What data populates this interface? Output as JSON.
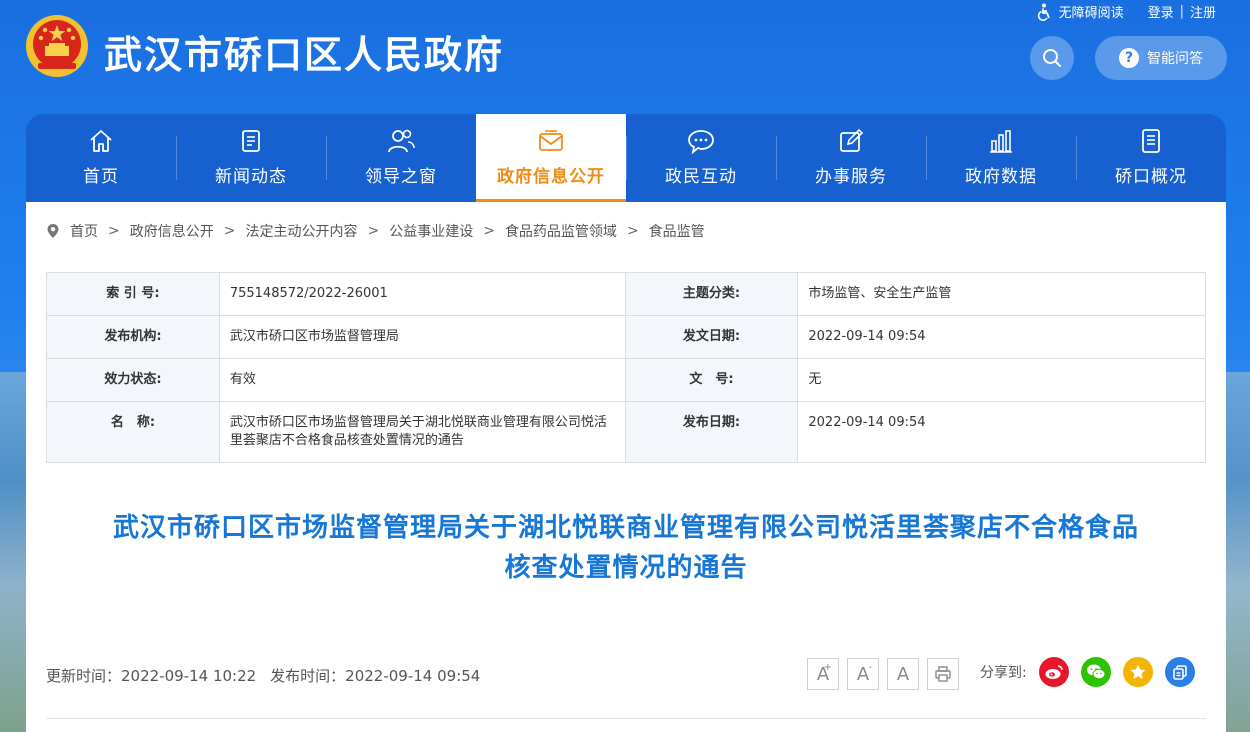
{
  "top": {
    "accessibility": "无障碍阅读",
    "login": "登录",
    "separator": "|",
    "register": "注册"
  },
  "header": {
    "site_title": "武汉市硚口区人民政府",
    "qa_label": "智能问答"
  },
  "nav": [
    {
      "label": "首页",
      "icon": "home-icon"
    },
    {
      "label": "新闻动态",
      "icon": "document-icon"
    },
    {
      "label": "领导之窗",
      "icon": "people-icon"
    },
    {
      "label": "政府信息公开",
      "icon": "mail-icon",
      "active": true
    },
    {
      "label": "政民互动",
      "icon": "chat-icon"
    },
    {
      "label": "办事服务",
      "icon": "edit-icon"
    },
    {
      "label": "政府数据",
      "icon": "bar-chart-icon"
    },
    {
      "label": "硚口概况",
      "icon": "list-icon"
    }
  ],
  "breadcrumb": [
    "首页",
    "政府信息公开",
    "法定主动公开内容",
    "公益事业建设",
    "食品药品监管领域",
    "食品监管"
  ],
  "breadcrumb_separator": ">",
  "info": {
    "index_label": "索 引 号:",
    "index_value": "755148572/2022-26001",
    "topic_label": "主题分类:",
    "topic_value": "市场监管、安全生产监管",
    "org_label": "发布机构:",
    "org_value": "武汉市硚口区市场监督管理局",
    "issue_date_label": "发文日期:",
    "issue_date_value": "2022-09-14 09:54",
    "status_label": "效力状态:",
    "status_value": "有效",
    "docno_label": "文　号:",
    "docno_value": "无",
    "name_label": "名　称:",
    "name_value": "武汉市硚口区市场监督管理局关于湖北悦联商业管理有限公司悦活里荟聚店不合格食品核查处置情况的通告",
    "publish_date_label": "发布日期:",
    "publish_date_value": "2022-09-14 09:54"
  },
  "article": {
    "title_line1": "武汉市硚口区市场监督管理局关于湖北悦联商业管理有限公司悦活里荟聚店不合格食品",
    "title_line2": "核查处置情况的通告",
    "updated": "更新时间：2022-09-14 10:22",
    "published": "发布时间：2022-09-14 09:54"
  },
  "tools": {
    "font_larger": "A",
    "font_larger_sup": "+",
    "font_smaller": "A",
    "font_smaller_sup": "-",
    "font_default": "A"
  },
  "share": {
    "label": "分享到:"
  },
  "colors": {
    "nav_bg": "#1760cf",
    "active_accent": "#f08c16",
    "title_blue": "#1677d6",
    "weibo": "#e6162d",
    "wechat": "#2dc100",
    "qzone": "#f5b400",
    "other": "#2b7ee8"
  }
}
